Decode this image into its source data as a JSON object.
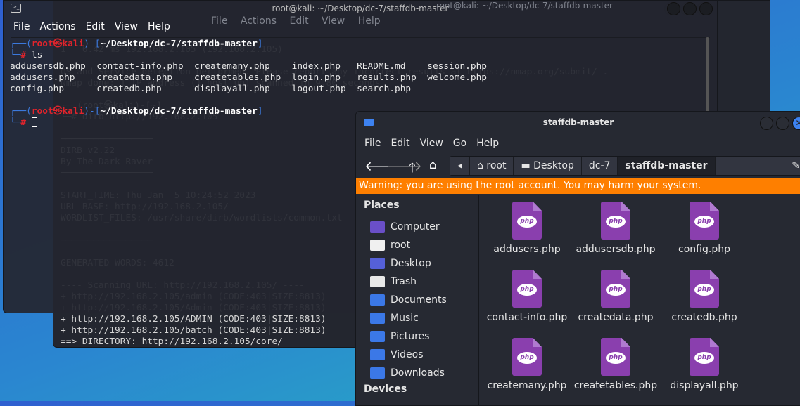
{
  "back_terminal": {
    "title": "root@kali: ~/Desktop/dc-7/staffdb-master",
    "menu": "File Actions Edit View Help",
    "lines": [
      "",
      "1   0.42 ms 192.168.2.105 (192.168.2.105)",
      "",
      "OS and Service detection performed. Please report any incorrect results at https://nmap.org/submit/ .",
      "Nmap done: 1 IP address (1 host up) scanned in 9.80 seconds",
      "",
      "┌──(root㉿kali)-[~]",
      "└─# dirb http://192.168.2.105",
      "",
      "─────────────────",
      "DIRB v2.22",
      "By The Dark Raver",
      "─────────────────",
      "",
      "START_TIME: Thu Jan  5 10:24:52 2023",
      "URL_BASE: http://192.168.2.105/",
      "WORDLIST_FILES: /usr/share/dirb/wordlists/common.txt",
      "",
      "─────────────────",
      "",
      "GENERATED WORDS: 4612",
      "",
      "---- Scanning URL: http://192.168.2.105/ ----",
      "+ http://192.168.2.105/admin (CODE:403|SIZE:8813)",
      "+ http://192.168.2.105/Admin (CODE:403|SIZE:8813)",
      "+ http://192.168.2.105/ADMIN (CODE:403|SIZE:8813)",
      "+ http://192.168.2.105/batch (CODE:403|SIZE:8813)",
      "==> DIRECTORY: http://192.168.2.105/core/"
    ]
  },
  "terminal": {
    "title": "root@kali: ~/Desktop/dc-7/staffdb-master",
    "menu": [
      "File",
      "Actions",
      "Edit",
      "View",
      "Help"
    ],
    "prompt_user": "root",
    "prompt_at": "㉿",
    "prompt_host": "kali",
    "prompt_path": "~/Desktop/dc-7/staffdb-master",
    "command": "ls",
    "ls_output": [
      "addusersdb.php  contact-info.php  createmany.php    index.php   README.md    session.php",
      "addusers.php    createdata.php    createtables.php  login.php   results.php  welcome.php",
      "config.php      createdb.php      displayall.php    logout.php  search.php"
    ]
  },
  "file_manager": {
    "title": "staffdb-master",
    "menu": [
      "File",
      "Edit",
      "View",
      "Go",
      "Help"
    ],
    "breadcrumbs": [
      "root",
      "Desktop",
      "dc-7",
      "staffdb-master"
    ],
    "warning": "Warning: you are using the root account. You may harm your system.",
    "warning_color": "#fe7f00",
    "places_header": "Places",
    "devices_header": "Devices",
    "places": [
      {
        "label": "Computer",
        "icon": "computer-icon"
      },
      {
        "label": "root",
        "icon": "home-folder-icon"
      },
      {
        "label": "Desktop",
        "icon": "desktop-icon"
      },
      {
        "label": "Trash",
        "icon": "trash-icon"
      },
      {
        "label": "Documents",
        "icon": "documents-folder-icon"
      },
      {
        "label": "Music",
        "icon": "music-folder-icon"
      },
      {
        "label": "Pictures",
        "icon": "pictures-folder-icon"
      },
      {
        "label": "Videos",
        "icon": "videos-folder-icon"
      },
      {
        "label": "Downloads",
        "icon": "downloads-folder-icon"
      }
    ],
    "files": [
      "addusers.php",
      "addusersdb.php",
      "config.php",
      "contact-info.php",
      "createdata.php",
      "createdb.php",
      "createmany.php",
      "createtables.php",
      "displayall.php"
    ],
    "file_icon_label": "php"
  }
}
